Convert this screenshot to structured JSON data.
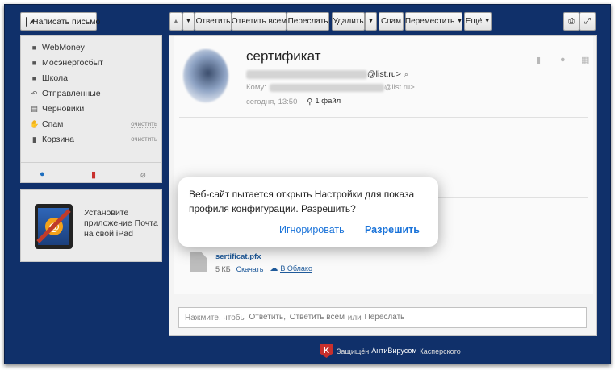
{
  "compose": {
    "label": "Написать письмо"
  },
  "toolbar": {
    "reply": "Ответить",
    "reply_all": "Ответить всем",
    "forward": "Переслать",
    "delete": "Удалить",
    "spam": "Спам",
    "move": "Переместить",
    "more": "Ещё",
    "caret": "▼",
    "up_caret": "▲"
  },
  "sidebar": {
    "folders": [
      {
        "label": "WebMoney",
        "icon": "folder-icon"
      },
      {
        "label": "Мосэнергосбыт",
        "icon": "folder-icon"
      },
      {
        "label": "Школа",
        "icon": "folder-icon"
      },
      {
        "label": "Отправленные",
        "icon": "sent-icon"
      },
      {
        "label": "Черновики",
        "icon": "draft-icon"
      },
      {
        "label": "Спам",
        "icon": "spam-icon",
        "action": "очистить"
      },
      {
        "label": "Корзина",
        "icon": "trash-icon",
        "action": "очистить"
      }
    ]
  },
  "promo": {
    "line1": "Установите",
    "line2": "приложение Почта",
    "line3": "на свой iPad"
  },
  "message": {
    "subject": "сертификат",
    "from_domain": "@list.ru>",
    "to_label": "Кому:",
    "to_domain": "@list.ru>",
    "date": "сегодня, 13:50",
    "files_link": "1 файл",
    "attachment_name": "sertificat.pfx",
    "attachment_size": "5 КБ",
    "download": "Скачать",
    "to_cloud": "В Облако"
  },
  "reply_box": {
    "prefix": "Нажмите, чтобы",
    "reply": "Ответить,",
    "reply_all": "Ответить всем",
    "or": "или",
    "forward": "Переслать"
  },
  "footer": {
    "prefix": "Защищён",
    "link": "АнтиВирусом",
    "suffix": "Касперского"
  },
  "alert": {
    "message": "Веб-сайт пытается открыть Настройки для показа профиля конфигурации. Разрешить?",
    "ignore": "Игнорировать",
    "allow": "Разрешить"
  },
  "colors": {
    "background": "#10306a",
    "link": "#1f5a9a",
    "alert_button": "#1a73d9",
    "bookmark": "#c8302d",
    "dot": "#1f6fbf"
  }
}
